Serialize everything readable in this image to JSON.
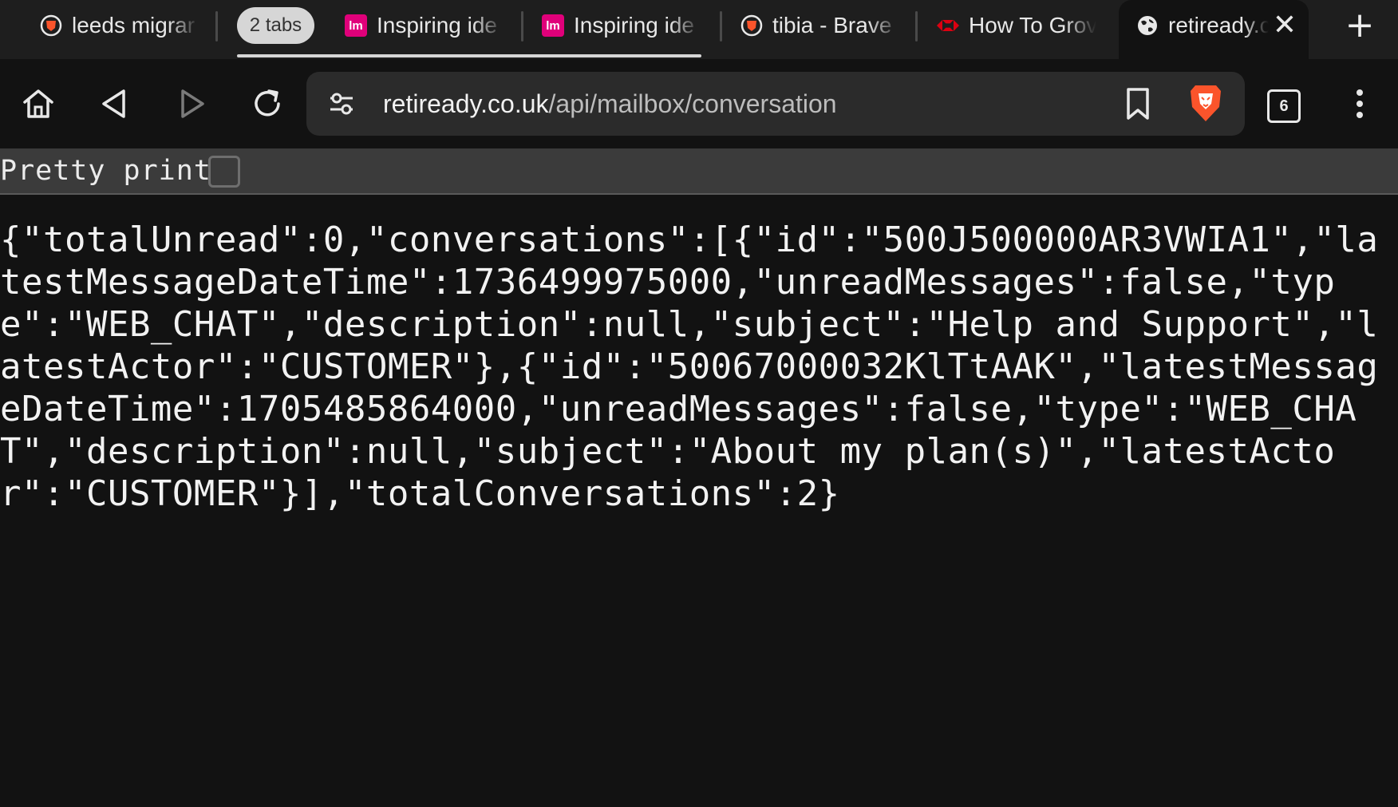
{
  "tabs": [
    {
      "title": "leeds migrar",
      "icon": "brave-lion-icon"
    },
    {
      "title": "Inspiring ide",
      "icon": "lm-icon"
    },
    {
      "title": "Inspiring ide",
      "icon": "lm-icon"
    },
    {
      "title": "tibia - Brave",
      "icon": "brave-lion-icon"
    },
    {
      "title": "How To Grov",
      "icon": "hsbc-icon"
    },
    {
      "title": "retiready.c",
      "icon": "globe-icon",
      "active": true
    }
  ],
  "tab_group": {
    "label": "2 tabs"
  },
  "lm_favicon_text": "lm",
  "toolbar": {
    "url_host": "retiready.co.uk",
    "url_path": "/api/mailbox/conversation",
    "tab_count": "6"
  },
  "pretty_print": {
    "label": "Pretty print",
    "checked": false
  },
  "json_body": "{\"totalUnread\":0,\"conversations\":[{\"id\":\"500J500000AR3VWIA1\",\"latestMessageDateTime\":1736499975000,\"unreadMessages\":false,\"type\":\"WEB_CHAT\",\"description\":null,\"subject\":\"Help and Support\",\"latestActor\":\"CUSTOMER\"},{\"id\":\"50067000032KlTtAAK\",\"latestMessageDateTime\":1705485864000,\"unreadMessages\":false,\"type\":\"WEB_CHAT\",\"description\":null,\"subject\":\"About my plan(s)\",\"latestActor\":\"CUSTOMER\"}],\"totalConversations\":2}",
  "colors": {
    "brave_orange": "#fb542b",
    "lm_pink": "#e0007a",
    "hsbc_red": "#db0011"
  }
}
